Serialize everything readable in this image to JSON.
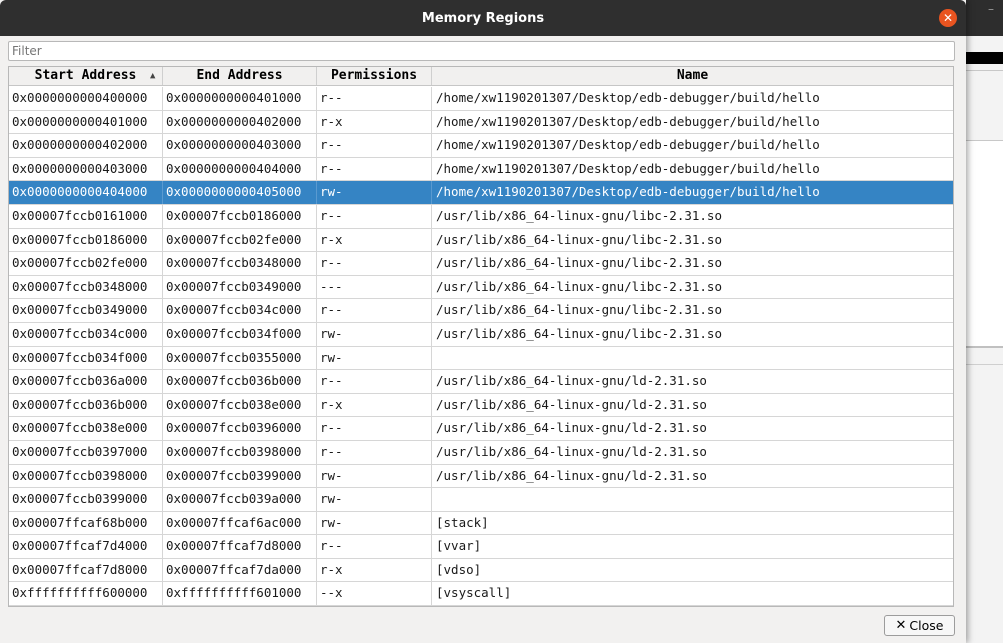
{
  "window": {
    "title": "Memory Regions"
  },
  "filter": {
    "placeholder": "Filter",
    "value": ""
  },
  "table": {
    "columns": [
      "Start Address",
      "End Address",
      "Permissions",
      "Name"
    ],
    "sort_indicator": "▲",
    "selected_index": 4,
    "rows": [
      [
        "0x0000000000400000",
        "0x0000000000401000",
        "r--",
        "/home/xw1190201307/Desktop/edb-debugger/build/hello"
      ],
      [
        "0x0000000000401000",
        "0x0000000000402000",
        "r-x",
        "/home/xw1190201307/Desktop/edb-debugger/build/hello"
      ],
      [
        "0x0000000000402000",
        "0x0000000000403000",
        "r--",
        "/home/xw1190201307/Desktop/edb-debugger/build/hello"
      ],
      [
        "0x0000000000403000",
        "0x0000000000404000",
        "r--",
        "/home/xw1190201307/Desktop/edb-debugger/build/hello"
      ],
      [
        "0x0000000000404000",
        "0x0000000000405000",
        "rw-",
        "/home/xw1190201307/Desktop/edb-debugger/build/hello"
      ],
      [
        "0x00007fccb0161000",
        "0x00007fccb0186000",
        "r--",
        "/usr/lib/x86_64-linux-gnu/libc-2.31.so"
      ],
      [
        "0x00007fccb0186000",
        "0x00007fccb02fe000",
        "r-x",
        "/usr/lib/x86_64-linux-gnu/libc-2.31.so"
      ],
      [
        "0x00007fccb02fe000",
        "0x00007fccb0348000",
        "r--",
        "/usr/lib/x86_64-linux-gnu/libc-2.31.so"
      ],
      [
        "0x00007fccb0348000",
        "0x00007fccb0349000",
        "---",
        "/usr/lib/x86_64-linux-gnu/libc-2.31.so"
      ],
      [
        "0x00007fccb0349000",
        "0x00007fccb034c000",
        "r--",
        "/usr/lib/x86_64-linux-gnu/libc-2.31.so"
      ],
      [
        "0x00007fccb034c000",
        "0x00007fccb034f000",
        "rw-",
        "/usr/lib/x86_64-linux-gnu/libc-2.31.so"
      ],
      [
        "0x00007fccb034f000",
        "0x00007fccb0355000",
        "rw-",
        ""
      ],
      [
        "0x00007fccb036a000",
        "0x00007fccb036b000",
        "r--",
        "/usr/lib/x86_64-linux-gnu/ld-2.31.so"
      ],
      [
        "0x00007fccb036b000",
        "0x00007fccb038e000",
        "r-x",
        "/usr/lib/x86_64-linux-gnu/ld-2.31.so"
      ],
      [
        "0x00007fccb038e000",
        "0x00007fccb0396000",
        "r--",
        "/usr/lib/x86_64-linux-gnu/ld-2.31.so"
      ],
      [
        "0x00007fccb0397000",
        "0x00007fccb0398000",
        "r--",
        "/usr/lib/x86_64-linux-gnu/ld-2.31.so"
      ],
      [
        "0x00007fccb0398000",
        "0x00007fccb0399000",
        "rw-",
        "/usr/lib/x86_64-linux-gnu/ld-2.31.so"
      ],
      [
        "0x00007fccb0399000",
        "0x00007fccb039a000",
        "rw-",
        ""
      ],
      [
        "0x00007ffcaf68b000",
        "0x00007ffcaf6ac000",
        "rw-",
        "[stack]"
      ],
      [
        "0x00007ffcaf7d4000",
        "0x00007ffcaf7d8000",
        "r--",
        "[vvar]"
      ],
      [
        "0x00007ffcaf7d8000",
        "0x00007ffcaf7da000",
        "r-x",
        "[vdso]"
      ],
      [
        "0xffffffffff600000",
        "0xffffffffff601000",
        "--x",
        "[vsyscall]"
      ]
    ]
  },
  "buttons": {
    "close_label": "Close",
    "close_icon": "✕"
  },
  "colors": {
    "selection": "#3584c4",
    "titlebar": "#2f2f2f",
    "close_circle": "#e95420"
  }
}
